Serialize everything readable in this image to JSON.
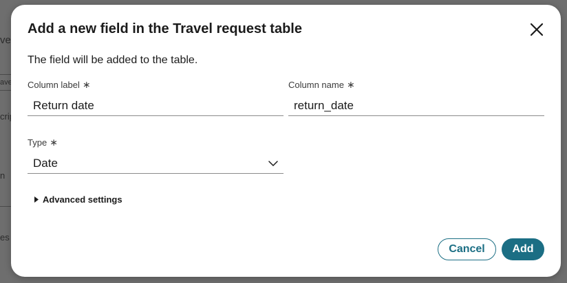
{
  "background": {
    "fragments": [
      "ve",
      "ave",
      "crip",
      "n",
      "es"
    ]
  },
  "dialog": {
    "title": "Add a new field in the Travel request table",
    "description": "The field will be added to the table.",
    "fields": {
      "column_label": {
        "label": "Column label",
        "value": "Return date"
      },
      "column_name": {
        "label": "Column name",
        "value": "return_date"
      },
      "type": {
        "label": "Type",
        "value": "Date"
      }
    },
    "required_marker": "∗",
    "advanced_settings": "Advanced settings",
    "buttons": {
      "cancel": "Cancel",
      "add": "Add"
    }
  },
  "colors": {
    "accent": "#1b6e84",
    "overlay": "#6e6e6e"
  },
  "icons": {
    "close": "close-icon",
    "chevron": "chevron-down-icon",
    "caret": "caret-right-icon"
  }
}
